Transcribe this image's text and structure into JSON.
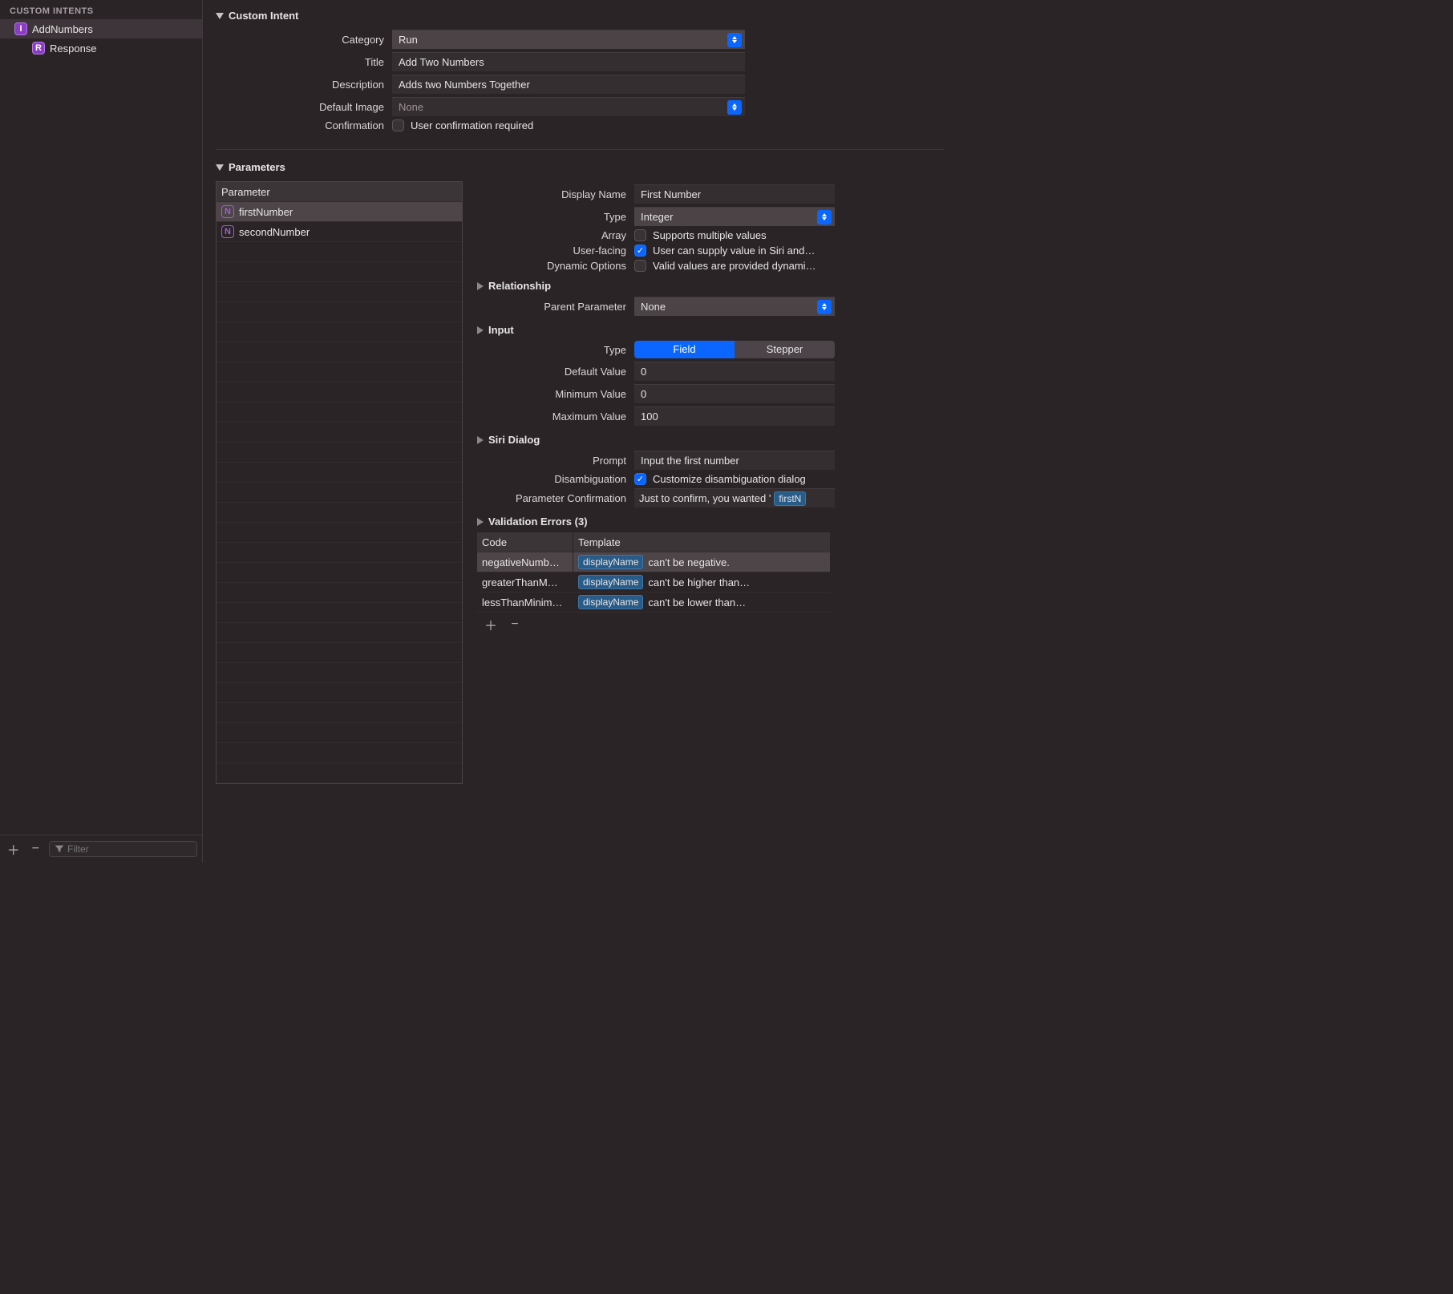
{
  "sidebar": {
    "header": "CUSTOM INTENTS",
    "items": [
      {
        "label": "AddNumbers",
        "badge": "I",
        "selected": true
      },
      {
        "label": "Response",
        "badge": "R",
        "selected": false,
        "child": true
      }
    ],
    "filter_placeholder": "Filter"
  },
  "customIntent": {
    "title": "Custom Intent",
    "fields": {
      "category_label": "Category",
      "category_value": "Run",
      "title_label": "Title",
      "title_value": "Add Two Numbers",
      "description_label": "Description",
      "description_value": "Adds two Numbers Together",
      "default_image_label": "Default Image",
      "default_image_value": "None",
      "confirmation_label": "Confirmation",
      "confirmation_text": "User confirmation required",
      "confirmation_checked": false
    }
  },
  "parameters": {
    "title": "Parameters",
    "table_header": "Parameter",
    "rows": [
      {
        "name": "firstNumber",
        "selected": true
      },
      {
        "name": "secondNumber",
        "selected": false
      }
    ],
    "blank_rows": 27
  },
  "details": {
    "display_name_label": "Display Name",
    "display_name_value": "First Number",
    "type_label": "Type",
    "type_value": "Integer",
    "array_label": "Array",
    "array_text": "Supports multiple values",
    "array_checked": false,
    "user_facing_label": "User-facing",
    "user_facing_text": "User can supply value in Siri and…",
    "user_facing_checked": true,
    "dyn_label": "Dynamic Options",
    "dyn_text": "Valid values are provided dynami…",
    "dyn_checked": false,
    "relationship_title": "Relationship",
    "parent_label": "Parent Parameter",
    "parent_value": "None",
    "input_title": "Input",
    "input_type_label": "Type",
    "input_type_options": [
      "Field",
      "Stepper"
    ],
    "input_type_active": 0,
    "default_label": "Default Value",
    "default_value": "0",
    "min_label": "Minimum Value",
    "min_value": "0",
    "max_label": "Maximum Value",
    "max_value": "100",
    "siri_title": "Siri Dialog",
    "prompt_label": "Prompt",
    "prompt_value": "Input the first number",
    "disamb_label": "Disambiguation",
    "disamb_text": "Customize disambiguation dialog",
    "disamb_checked": true,
    "confirm_label": "Parameter Confirmation",
    "confirm_prefix": "Just to confirm, you wanted '",
    "confirm_token": "firstN",
    "ve_title": "Validation Errors (3)",
    "ve_headers": [
      "Code",
      "Template"
    ],
    "ve_token": "displayName",
    "ve_rows": [
      {
        "code": "negativeNumb…",
        "suffix": " can't be negative.",
        "selected": true
      },
      {
        "code": "greaterThanM…",
        "suffix": " can't be higher than…",
        "selected": false
      },
      {
        "code": "lessThanMinim…",
        "suffix": " can't be lower than…",
        "selected": false
      }
    ]
  }
}
